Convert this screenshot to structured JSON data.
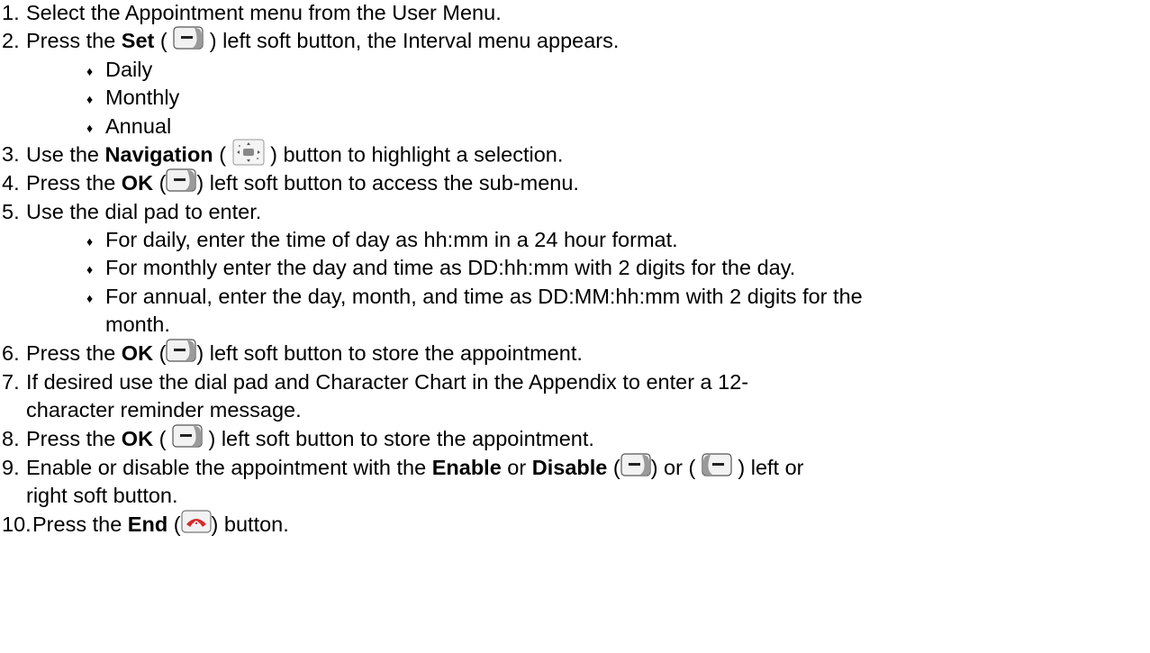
{
  "doc": {
    "l1": {
      "num": "1.",
      "text": "Select the Appointment menu from the User Menu."
    },
    "l2": {
      "num": "2.",
      "a": "Press the ",
      "b": "Set",
      "c": " ( ",
      "d": " ) left soft button, the Interval menu appears."
    },
    "b1": "Daily",
    "b2": "Monthly",
    "b3": "Annual",
    "l3": {
      "num": "3.",
      "a": "Use the ",
      "b": "Navigation",
      "c": " ( ",
      "d": " ) button to highlight a selection."
    },
    "l4": {
      "num": "4.",
      "a": "Press the ",
      "b": "OK",
      "c": " (",
      "d": ") left soft button to access the sub-menu."
    },
    "l5": {
      "num": "5.",
      "text": "Use the dial pad to enter."
    },
    "b4": "For daily, enter the time of day as hh:mm in a 24 hour format.",
    "b5": "For monthly enter the day and time as DD:hh:mm with 2 digits for the day.",
    "b6": "For annual, enter the day, month, and time as DD:MM:hh:mm with 2 digits for the",
    "b6cont": "month.",
    "l6": {
      "num": "6.",
      "a": "Press the ",
      "b": "OK",
      "c": " (",
      "d": ") left soft button to store the appointment."
    },
    "l7": {
      "num": "7.",
      "text": "If desired use the dial pad and Character Chart in the Appendix to enter a 12-"
    },
    "l7cont": "character reminder message.",
    "l8": {
      "num": "8.",
      "a": "Press the ",
      "b": "OK",
      "c": " ( ",
      "d": " ) left soft button to store the appointment."
    },
    "l9": {
      "num": "9.",
      "a": "Enable or disable the appointment with the ",
      "b": "Enable",
      "c": " or ",
      "e": "Disable",
      "f": " (",
      "g": ") or ( ",
      "h": " ) left or"
    },
    "l9cont": "right soft button.",
    "l10": {
      "num": "10.",
      "a": "Press the ",
      "b": "End",
      "c": " (",
      "d": ") button."
    }
  }
}
